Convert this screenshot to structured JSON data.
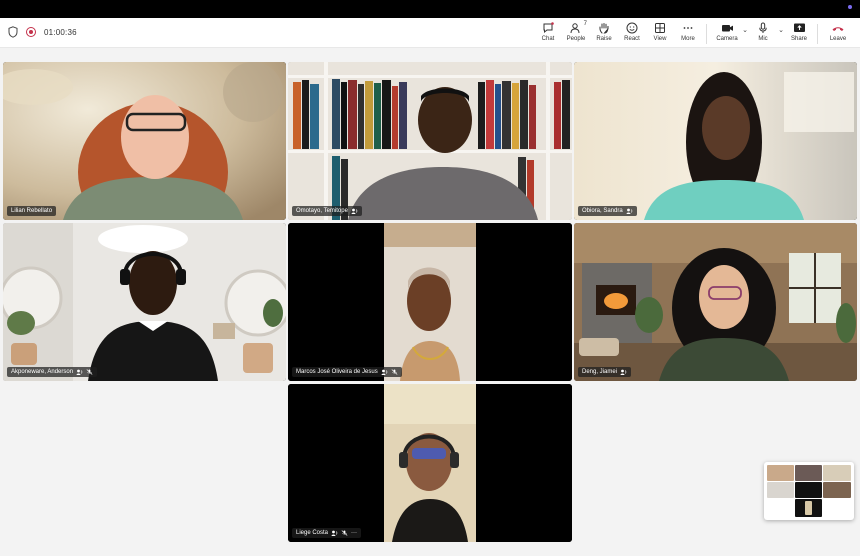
{
  "meeting": {
    "elapsed_time": "01:00:36"
  },
  "toolbar": {
    "chat_label": "Chat",
    "people_label": "People",
    "people_count": "7",
    "raise_label": "Raise",
    "react_label": "React",
    "view_label": "View",
    "more_label": "More",
    "camera_label": "Camera",
    "mic_label": "Mic",
    "share_label": "Share",
    "leave_label": "Leave"
  },
  "participants": [
    {
      "name": "Lilian Rebellato",
      "muted": false
    },
    {
      "name": "Omotayo, Temitope",
      "muted": false
    },
    {
      "name": "Obiora, Sandra",
      "muted": false
    },
    {
      "name": "Akponeware, Anderson",
      "muted": true
    },
    {
      "name": "Marcos José Oliveira de Jesus",
      "muted": true
    },
    {
      "name": "Deng, Jiamei",
      "muted": false
    },
    {
      "name": "Liege Costa",
      "muted": true,
      "more": "···"
    }
  ],
  "colors": {
    "leave": "#c4314b",
    "accent": "#7b6cf0",
    "toolbar_bg": "#ffffff",
    "stage_bg": "#f3f3f3"
  }
}
